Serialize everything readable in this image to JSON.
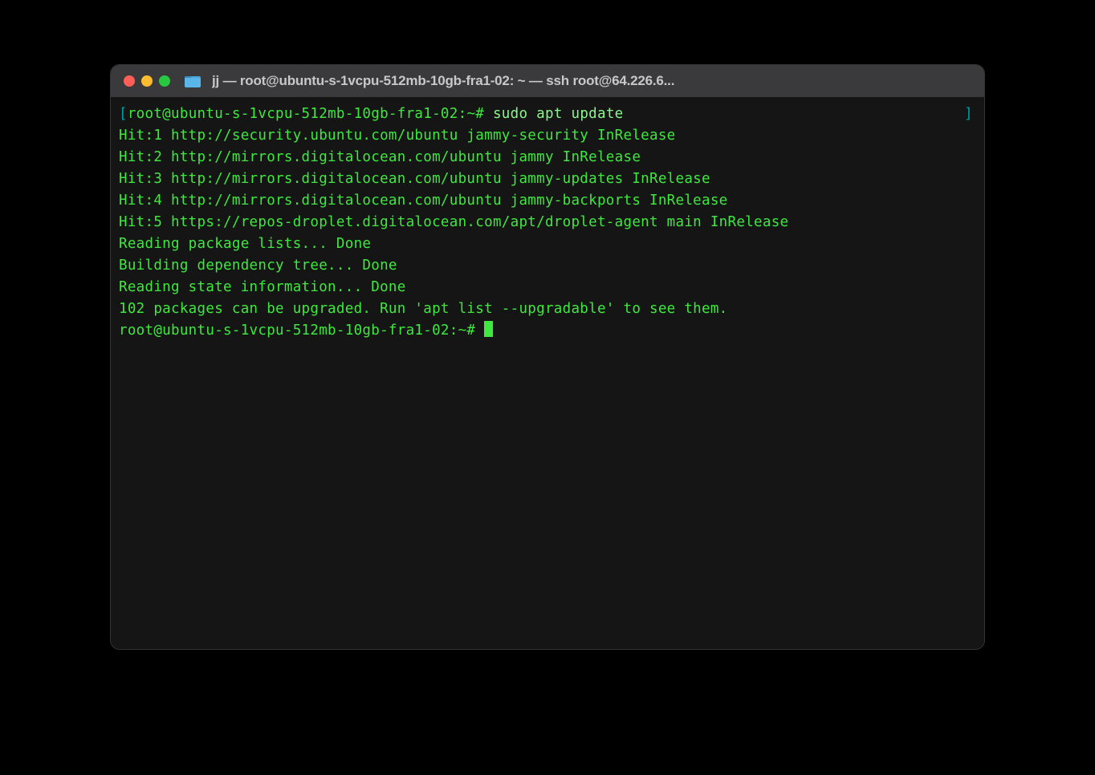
{
  "window": {
    "title": "jj — root@ubuntu-s-1vcpu-512mb-10gb-fra1-02: ~ — ssh root@64.226.6..."
  },
  "terminal": {
    "prompt_open_bracket": "[",
    "prompt_close_bracket": "]",
    "prompt": "root@ubuntu-s-1vcpu-512mb-10gb-fra1-02:~#",
    "command": "sudo apt update",
    "output": [
      "Hit:1 http://security.ubuntu.com/ubuntu jammy-security InRelease",
      "Hit:2 http://mirrors.digitalocean.com/ubuntu jammy InRelease",
      "Hit:3 http://mirrors.digitalocean.com/ubuntu jammy-updates InRelease",
      "Hit:4 http://mirrors.digitalocean.com/ubuntu jammy-backports InRelease",
      "Hit:5 https://repos-droplet.digitalocean.com/apt/droplet-agent main InRelease",
      "Reading package lists... Done",
      "Building dependency tree... Done",
      "Reading state information... Done",
      "102 packages can be upgraded. Run 'apt list --upgradable' to see them."
    ],
    "prompt2": "root@ubuntu-s-1vcpu-512mb-10gb-fra1-02:~# "
  }
}
